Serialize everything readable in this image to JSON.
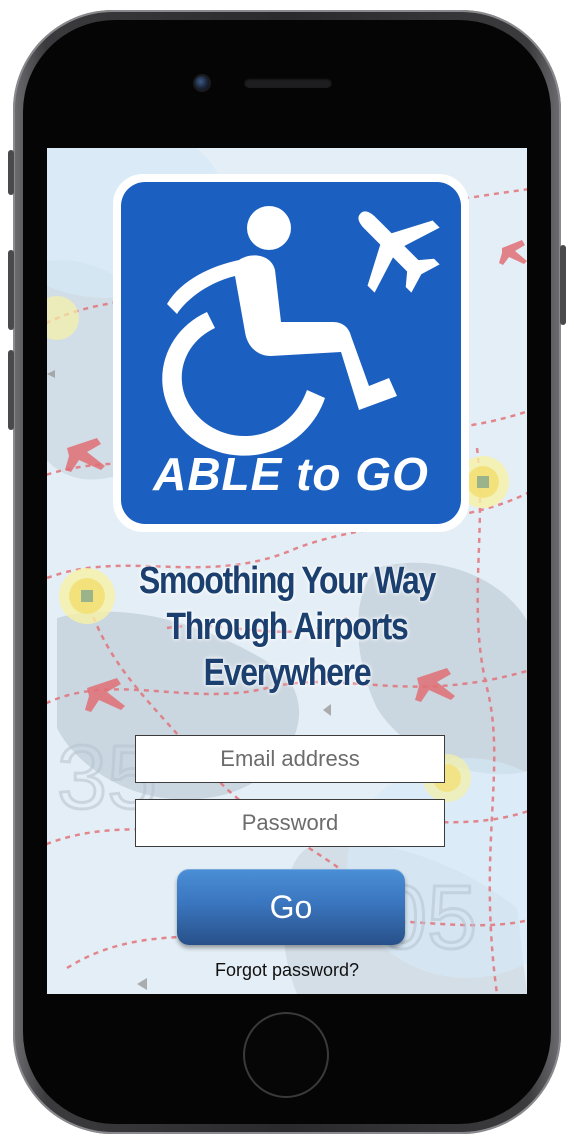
{
  "app": {
    "logo_text": "ABLE to GO",
    "brand_color": "#1b5fc0",
    "tagline_lines": [
      "Smoothing Your Way",
      "Through Airports",
      "Everywhere"
    ]
  },
  "login": {
    "email_placeholder": "Email address",
    "password_placeholder": "Password",
    "go_label": "Go",
    "forgot_password_label": "Forgot password?"
  },
  "icons": {
    "accessibility": "wheelchair-icon",
    "airplane": "airplane-icon"
  }
}
